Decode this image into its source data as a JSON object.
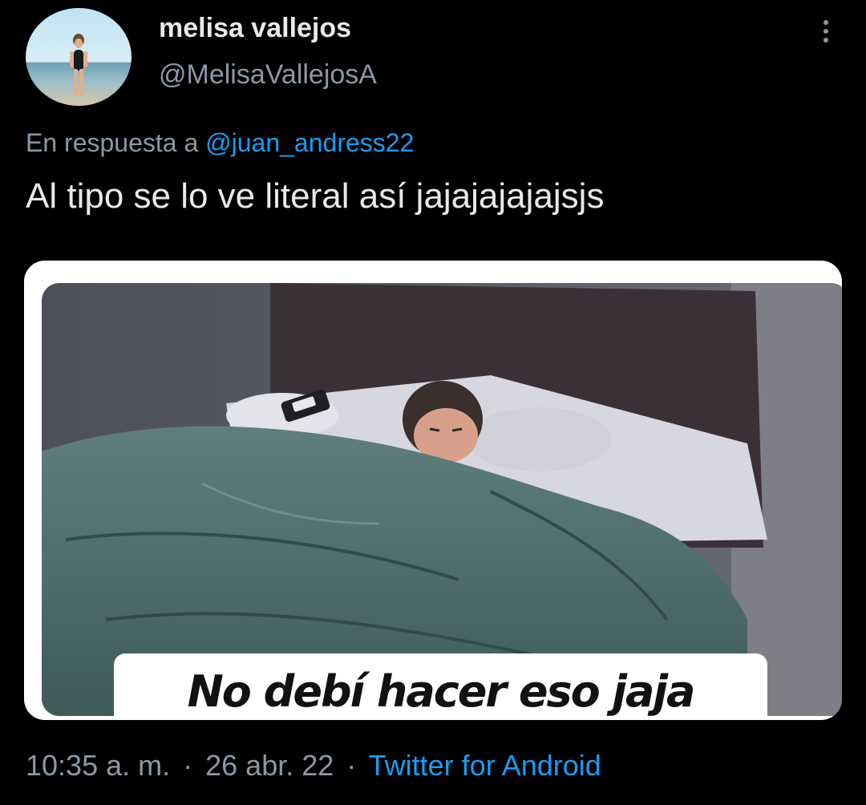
{
  "tweet": {
    "author": {
      "display_name": "melisa vallejos",
      "handle": "@MelisaVallejosA"
    },
    "reply_prefix": "En respuesta a",
    "reply_to": "@juan_andress22",
    "text": "Al tipo se lo ve literal así jajajajajajsjs",
    "media": {
      "caption": "No debí hacer eso jaja"
    },
    "time": "10:35 a. m.",
    "date": "26 abr. 22",
    "separator": "·",
    "source": "Twitter for Android"
  },
  "colors": {
    "background": "#000000",
    "primary_text": "#e7e9ea",
    "secondary_text": "#8b98a5",
    "link": "#1d9bf0"
  },
  "icons": {
    "more": "more-vertical-icon"
  }
}
